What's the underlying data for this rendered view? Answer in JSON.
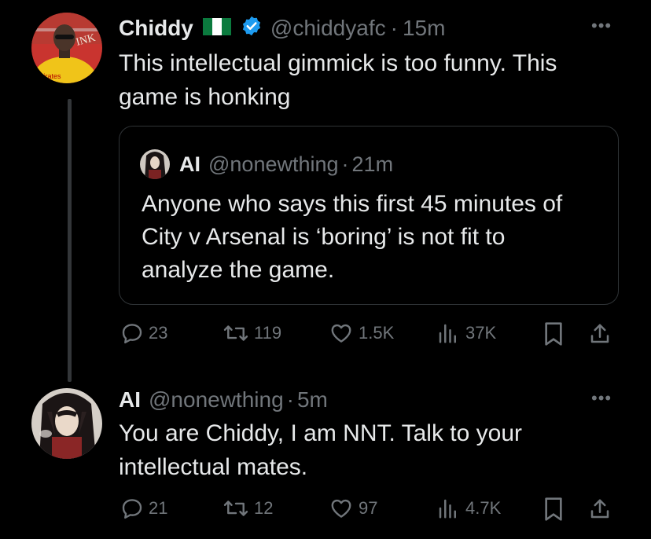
{
  "colors": {
    "background": "#000000",
    "text": "#e7e9ea",
    "muted": "#71767b",
    "verified": "#1d9bf0",
    "border": "#2f3336"
  },
  "tweets": [
    {
      "display_name": "Chiddy",
      "flag_icon": "nigeria-flag-icon",
      "verified_icon": "verified-badge-icon",
      "handle": "@chiddyafc",
      "separator": "·",
      "time": "15m",
      "more": "•••",
      "text_lines": [
        "This intellectual gimmick is too funny. This",
        "game is honking"
      ],
      "quote": {
        "display_name": "AI",
        "handle": "@nonewthing",
        "separator": "·",
        "time": "21m",
        "text_lines": [
          "Anyone who says this first 45 minutes of",
          "City v Arsenal is ‘boring’ is not fit to",
          "analyze the game."
        ]
      },
      "actions": {
        "replies": "23",
        "reposts": "119",
        "likes": "1.5K",
        "views": "37K"
      }
    },
    {
      "display_name": "AI",
      "handle": "@nonewthing",
      "separator": "·",
      "time": "5m",
      "more": "•••",
      "text_lines": [
        "You are Chiddy, I am NNT. Talk to your",
        "intellectual mates."
      ],
      "actions": {
        "replies": "21",
        "reposts": "12",
        "likes": "97",
        "views": "4.7K"
      }
    }
  ]
}
